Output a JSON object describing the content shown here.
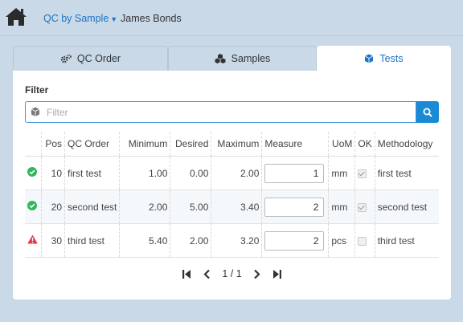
{
  "header": {
    "breadcrumb": "QC by Sample",
    "user_name": "James Bonds"
  },
  "tabs": [
    {
      "label": "QC Order",
      "icon": "cogs-icon",
      "active": false
    },
    {
      "label": "Samples",
      "icon": "cubes-icon",
      "active": false
    },
    {
      "label": "Tests",
      "icon": "cube-icon",
      "active": true
    }
  ],
  "filter": {
    "label": "Filter",
    "placeholder": "Filter",
    "value": ""
  },
  "table": {
    "columns": [
      "Pos",
      "QC Order",
      "Minimum",
      "Desired",
      "Maximum",
      "Measure",
      "UoM",
      "OK",
      "Methodology"
    ],
    "rows": [
      {
        "status": "ok",
        "status_icon": "check-circle-icon",
        "status_color": "#2eb85c",
        "pos": "10",
        "qc_order": "first test",
        "minimum": "1.00",
        "desired": "0.00",
        "maximum": "2.00",
        "measure": "1",
        "uom": "mm",
        "ok": true,
        "methodology": "first test"
      },
      {
        "status": "ok",
        "status_icon": "check-circle-icon",
        "status_color": "#2eb85c",
        "pos": "20",
        "qc_order": "second test",
        "minimum": "2.00",
        "desired": "5.00",
        "maximum": "3.40",
        "measure": "2",
        "uom": "mm",
        "ok": true,
        "methodology": "second test"
      },
      {
        "status": "warning",
        "status_icon": "warning-triangle-icon",
        "status_color": "#e8334a",
        "pos": "30",
        "qc_order": "third test",
        "minimum": "5.40",
        "desired": "2.00",
        "maximum": "3.20",
        "measure": "2",
        "uom": "pcs",
        "ok": false,
        "methodology": "third test"
      }
    ]
  },
  "pager": {
    "page_info": "1 / 1"
  },
  "colors": {
    "accent": "#1a73c7",
    "search_button": "#1a8ad4",
    "background": "#c9d9e8"
  }
}
